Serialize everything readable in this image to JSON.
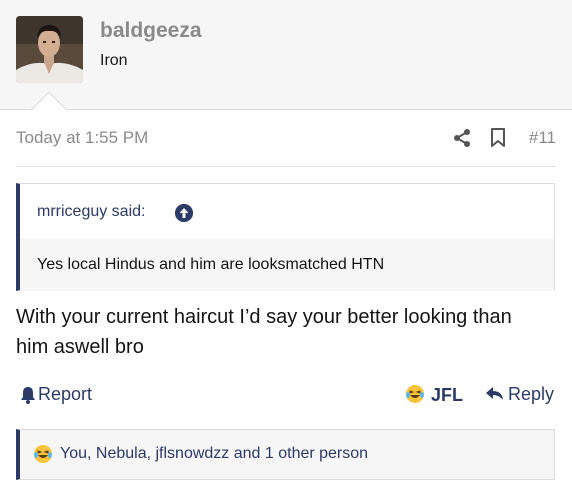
{
  "post": {
    "author": {
      "username": "baldgeeza",
      "user_title": "Iron",
      "avatar_icon": "user-avatar"
    },
    "meta": {
      "timestamp": "Today at 1:55 PM",
      "share_icon": "share-icon",
      "bookmark_icon": "bookmark-icon",
      "post_number": "#11"
    },
    "quote": {
      "author_label": "mrriceguy said:",
      "jump_icon": "arrow-up-circle-icon",
      "text": "Yes local Hindus and him are looksmatched HTN"
    },
    "message_lines": [
      "With your current haircut I’d say your better looking than",
      "him aswell bro"
    ],
    "actions": {
      "report_label": "Report",
      "reaction_label": "JFL",
      "reply_label": "Reply"
    },
    "reactions": {
      "summary": "You, Nebula, jflsnowdzz and 1 other person",
      "emoji_icon": "laughing-crying-emoji-icon"
    }
  },
  "colors": {
    "accent": "#2b3a67",
    "muted": "#8a8a8a",
    "header_bg": "#f6f6f6",
    "border": "#dcdcdc"
  }
}
